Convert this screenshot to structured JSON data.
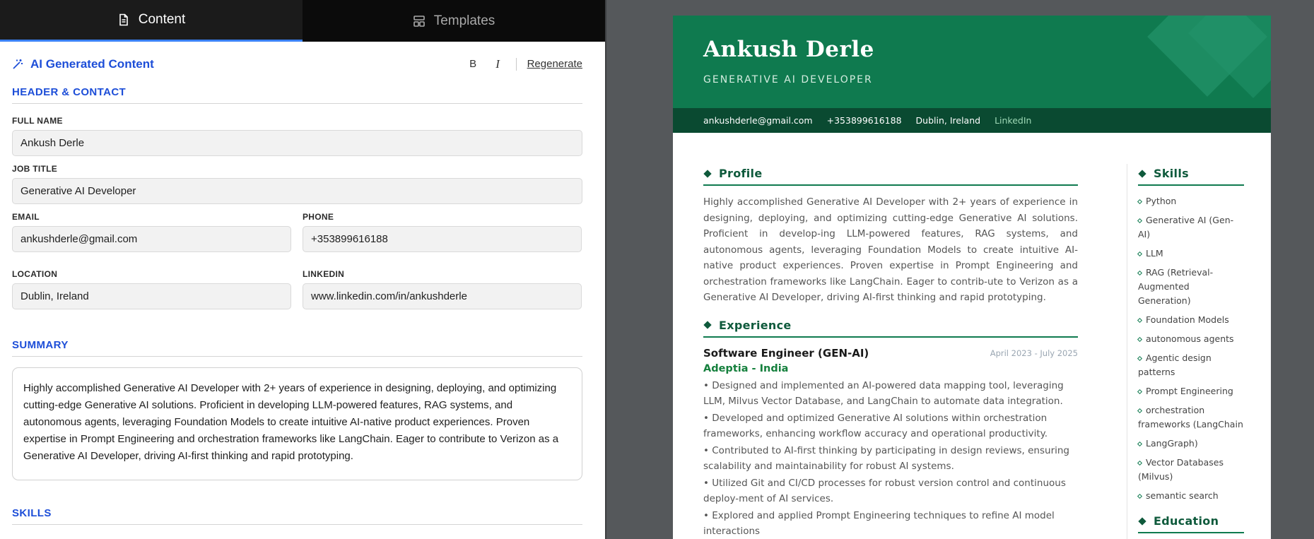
{
  "tabs": [
    {
      "label": "Content",
      "icon": "document-icon",
      "active": true
    },
    {
      "label": "Templates",
      "icon": "layout-icon",
      "active": false
    }
  ],
  "ai_bar": {
    "title": "AI Generated Content",
    "bold_label": "B",
    "italic_label": "I",
    "regenerate_label": "Regenerate"
  },
  "header_contact": {
    "section_title": "HEADER & CONTACT",
    "full_name_label": "FULL NAME",
    "full_name": "Ankush Derle",
    "job_title_label": "JOB TITLE",
    "job_title": "Generative AI Developer",
    "email_label": "EMAIL",
    "email": "ankushderle@gmail.com",
    "phone_label": "PHONE",
    "phone": "+353899616188",
    "location_label": "LOCATION",
    "location": "Dublin, Ireland",
    "linkedin_label": "LINKEDIN",
    "linkedin": "www.linkedin.com/in/ankushderle"
  },
  "summary": {
    "section_title": "SUMMARY",
    "text": "Highly accomplished Generative AI Developer with 2+ years of experience in designing, deploying, and optimizing cutting-edge Generative AI solutions. Proficient in developing LLM-powered features, RAG systems, and autonomous agents, leveraging Foundation Models to create intuitive AI-native product experiences. Proven expertise in Prompt Engineering and orchestration frameworks like LangChain. Eager to contribute to Verizon as a Generative AI Developer, driving AI-first thinking and rapid prototyping."
  },
  "skills_section_title": "SKILLS",
  "resume": {
    "name": "Ankush Derle",
    "title": "GENERATIVE AI DEVELOPER",
    "contact": {
      "email": "ankushderle@gmail.com",
      "phone": "+353899616188",
      "location": "Dublin, Ireland",
      "linkedin": "LinkedIn"
    },
    "profile_heading": "Profile",
    "profile_text": "Highly accomplished Generative AI Developer with 2+ years of experience in designing, deploying, and optimizing cutting-edge Generative AI solutions. Proficient in develop-ing LLM-powered features, RAG systems, and autonomous agents, leveraging Foundation Models to create intuitive AI-native product experiences. Proven expertise in Prompt Engineering and orchestration frameworks like LangChain. Eager to contrib-ute to Verizon as a Generative AI Developer, driving AI-first thinking and rapid prototyping.",
    "experience_heading": "Experience",
    "experience": {
      "role": "Software Engineer (GEN-AI)",
      "dates": "April 2023 - July 2025",
      "company": "Adeptia - India",
      "bullets": [
        "• Designed and implemented an AI-powered data mapping tool, leveraging LLM, Milvus Vector Database, and LangChain to automate data integration.",
        "• Developed and optimized Generative AI solutions within orchestration frameworks, enhancing workflow accuracy and operational productivity.",
        "• Contributed to AI-first thinking by participating in design reviews, ensuring scalability and maintainability for robust AI systems.",
        "• Utilized Git and CI/CD processes for robust version control and continuous deploy-ment of AI services.",
        "• Explored and applied Prompt Engineering techniques to refine AI model interactions"
      ]
    },
    "skills_heading": "Skills",
    "skills": [
      "Python",
      "Generative AI (Gen-AI)",
      "LLM",
      "RAG (Retrieval-Augmented Generation)",
      "Foundation Models",
      "autonomous agents",
      "Agentic design patterns",
      "Prompt Engineering",
      "orchestration frameworks (LangChain",
      "LangGraph)",
      "Vector Databases (Milvus)",
      "semantic search"
    ],
    "education_heading": "Education"
  },
  "colors": {
    "accent_blue": "#1d4ed8",
    "resume_green": "#0f7a4f",
    "resume_dark_green": "#0a4a31",
    "company_green": "#15803d"
  }
}
